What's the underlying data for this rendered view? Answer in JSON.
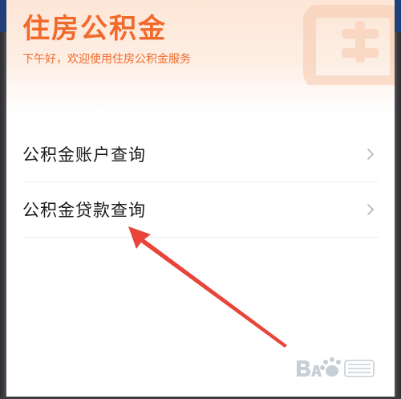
{
  "header": {
    "title": "住房公积金",
    "greeting": "下午好，欢迎使用住房公积金服务"
  },
  "menu": {
    "items": [
      {
        "label": "公积金账户查询",
        "icon": "chevron-right-icon"
      },
      {
        "label": "公积金贷款查询",
        "icon": "chevron-right-icon"
      }
    ]
  },
  "watermark": {
    "logo_text": "Baidu经验"
  },
  "colors": {
    "accent": "#f06a2c",
    "header_gradient_top": "#fde6d6",
    "annotation_arrow": "#e8443a"
  }
}
